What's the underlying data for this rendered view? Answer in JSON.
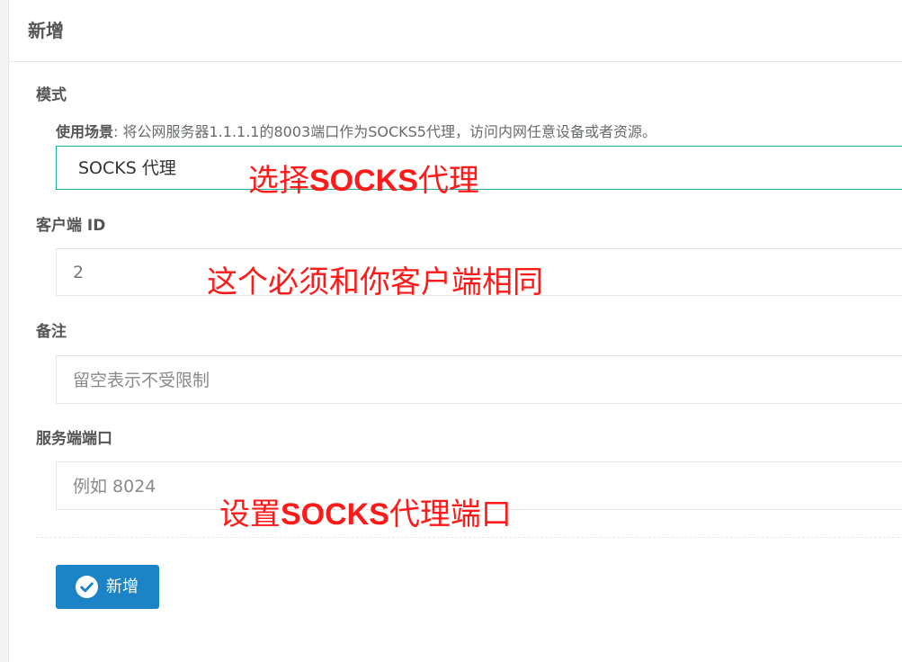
{
  "header": {
    "title": "新增"
  },
  "form": {
    "mode": {
      "label": "模式",
      "hint_label": "使用场景",
      "hint_text": ": 将公网服务器1.1.1.1的8003端口作为SOCKS5代理，访问内网任意设备或者资源。",
      "value": "SOCKS 代理"
    },
    "client_id": {
      "label": "客户端 ID",
      "value": "2"
    },
    "remark": {
      "label": "备注",
      "placeholder": "留空表示不受限制"
    },
    "server_port": {
      "label": "服务端端口",
      "placeholder": "例如 8024"
    },
    "submit_label": "新增"
  },
  "annotations": {
    "mode_pre": "选择",
    "mode_bold": "SOCKS",
    "mode_post": "代理",
    "client": "这个必须和你客户端相同",
    "port_pre": "设置",
    "port_bold": "SOCKS",
    "port_post": "代理端口"
  },
  "colors": {
    "primary_button": "#1c84c6",
    "select_border": "#1ab394",
    "annotation": "#ff1a1a"
  },
  "icons": {
    "submit": "check-circle-icon"
  }
}
